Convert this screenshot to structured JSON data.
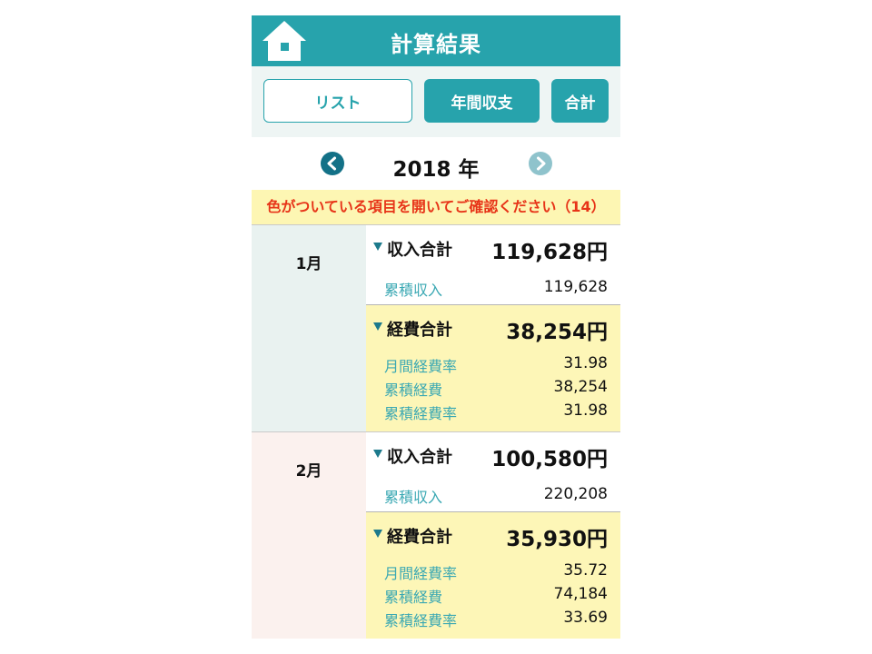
{
  "header": {
    "title": "計算結果",
    "home_icon": "home-icon"
  },
  "tabs": {
    "list": "リスト",
    "annual": "年間収支",
    "total": "合計"
  },
  "year_nav": {
    "year_label": "2018 年",
    "prev_icon": "chevron-left-icon",
    "next_icon": "chevron-right-icon"
  },
  "notice": {
    "text": "色がついている項目を開いてご確認ください（14）"
  },
  "months": [
    {
      "label": "1月",
      "income_label": "収入合計",
      "income_total": "119,628円",
      "cumulative_income_label": "累積収入",
      "cumulative_income": "119,628",
      "expense_label": "経費合計",
      "expense_total": "38,254円",
      "rows": [
        {
          "label": "月間経費率",
          "value": "31.98"
        },
        {
          "label": "累積経費",
          "value": "38,254"
        },
        {
          "label": "累積経費率",
          "value": "31.98"
        }
      ]
    },
    {
      "label": "2月",
      "income_label": "収入合計",
      "income_total": "100,580円",
      "cumulative_income_label": "累積収入",
      "cumulative_income": "220,208",
      "expense_label": "経費合計",
      "expense_total": "35,930円",
      "rows": [
        {
          "label": "月間経費率",
          "value": "35.72"
        },
        {
          "label": "累積経費",
          "value": "74,184"
        },
        {
          "label": "累積経費率",
          "value": "33.69"
        }
      ]
    }
  ],
  "colors": {
    "accent": "#27a3ac",
    "expense_bg": "#fdf6b7",
    "notice_text": "#e73418",
    "month1_bg": "#e9f2f0",
    "month2_bg": "#fbf1ee",
    "sub_label": "#3aa8b3"
  }
}
